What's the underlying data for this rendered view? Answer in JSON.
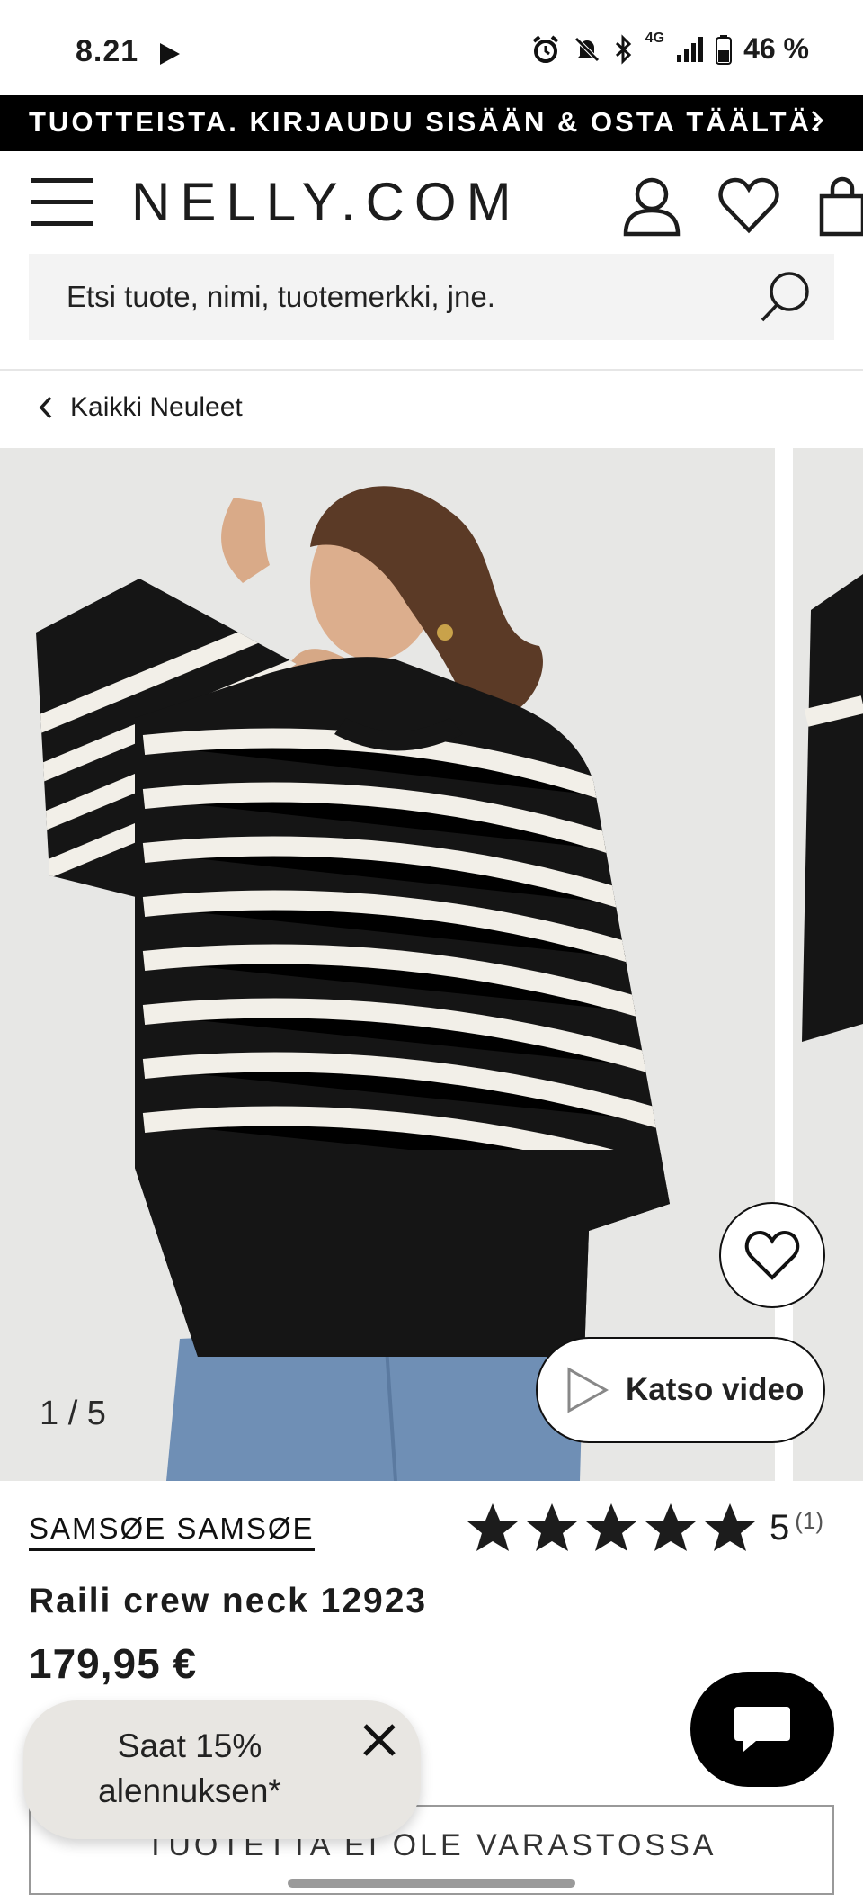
{
  "status_bar": {
    "time": "8.21",
    "network": "4G",
    "battery": "46 %"
  },
  "promo_banner": {
    "text": "TUOTTEISTA. KIRJAUDU SISÄÄN & OSTA TÄÄLTÄ:"
  },
  "header": {
    "logo": "NELLY.COM"
  },
  "search": {
    "placeholder": "Etsi tuote, nimi, tuotemerkki, jne."
  },
  "breadcrumb": {
    "label": "Kaikki Neuleet"
  },
  "gallery": {
    "counter": "1 / 5",
    "current": 1,
    "total": 5,
    "video_label": "Katso video"
  },
  "product": {
    "brand": "SAMSØE SAMSØE",
    "name": "Raili crew neck 12923",
    "price": "179,95 €",
    "rating": {
      "value": "5",
      "count": "(1)",
      "stars_filled": 5,
      "stars_total": 5
    },
    "stock_label": "TUOTETTA EI OLE VARASTOSSA"
  },
  "discount_popup": {
    "text": "Saat 15% alennuksen*"
  },
  "colors": {
    "banner_bg": "#000000",
    "search_bg": "#f3f3f3",
    "popup_bg": "#e8e6e2",
    "text": "#1c1c1c"
  }
}
